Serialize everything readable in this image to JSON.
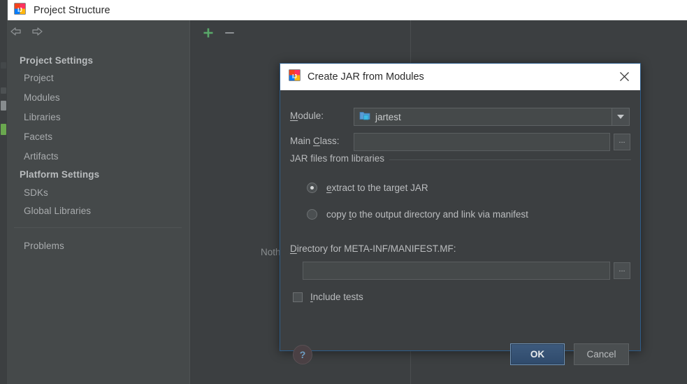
{
  "window": {
    "title": "Project Structure",
    "app_icon": "intellij-idea-icon"
  },
  "toolbar": {
    "back_icon": "arrow-left-icon",
    "forward_icon": "arrow-right-icon"
  },
  "sidebar": {
    "groups": [
      {
        "label": "Project Settings",
        "items": [
          {
            "label": "Project"
          },
          {
            "label": "Modules"
          },
          {
            "label": "Libraries"
          },
          {
            "label": "Facets"
          },
          {
            "label": "Artifacts"
          }
        ]
      },
      {
        "label": "Platform Settings",
        "items": [
          {
            "label": "SDKs"
          },
          {
            "label": "Global Libraries"
          }
        ]
      }
    ],
    "problems_label": "Problems"
  },
  "content": {
    "add_icon": "plus-icon",
    "remove_icon": "minus-icon",
    "empty_text": "Nothing to show"
  },
  "dialog": {
    "title": "Create JAR from Modules",
    "app_icon": "intellij-idea-icon",
    "close_icon": "close-icon",
    "module": {
      "label_pre": "M",
      "label_mnemonic": "",
      "label": "Module:",
      "value": "jartest",
      "icon": "module-folder-icon",
      "arrow_icon": "chevron-down-icon"
    },
    "main_class": {
      "label": "Main Class:",
      "value": "",
      "browse_label": "..."
    },
    "jar_group": {
      "title": "JAR files from libraries",
      "options": [
        {
          "label": "extract to the target JAR",
          "selected": true
        },
        {
          "label": "copy to the output directory and link via manifest",
          "selected": false
        }
      ]
    },
    "manifest": {
      "label": "Directory for META-INF/MANIFEST.MF:",
      "value": "",
      "browse_label": "..."
    },
    "include_tests": {
      "label": "Include tests",
      "checked": false
    },
    "help_label": "?",
    "ok_label": "OK",
    "cancel_label": "Cancel"
  },
  "colors": {
    "accent_border": "#2e5d8a",
    "panel_bg": "#3c3f41",
    "sidebar_bg": "#45494a",
    "field_bg": "#45494a",
    "text": "#bbbdbf",
    "plus_green": "#6aa84f",
    "ok_button": "#3d5a7d"
  }
}
